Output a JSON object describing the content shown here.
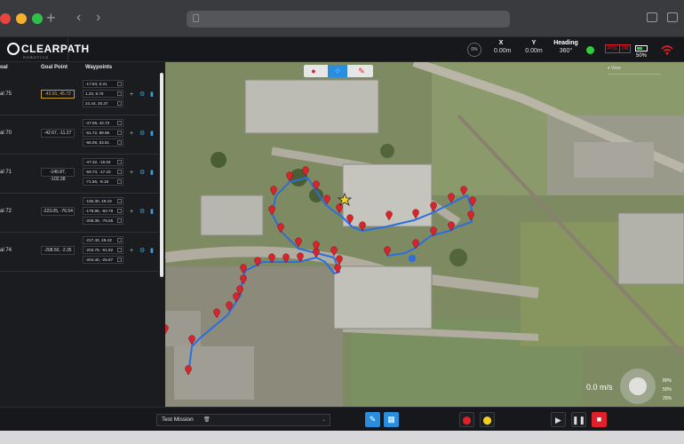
{
  "app": {
    "brand": "CLEARPATH",
    "brand_sub": "ROBOTICS"
  },
  "status": {
    "speed_pct": "0%",
    "x_label": "X",
    "x_value": "0.00m",
    "y_label": "Y",
    "y_value": "0.00m",
    "heading_label": "Heading",
    "heading_value": "360°",
    "estop1": "POS",
    "estop2": "DR",
    "battery_pct": "50%",
    "battery_level": 0.5
  },
  "panel": {
    "col_goal": "oal",
    "col_goal_point": "Goal Point",
    "col_waypoints": "Waypoints",
    "goals": [
      {
        "name": "al 75",
        "goal_point": "-42.91, 45.72",
        "highlight": true,
        "waypoints": [
          "-17.63, 0.31",
          "1.23, 9.70",
          "24.44, 20.37"
        ]
      },
      {
        "name": "al 70",
        "goal_point": "-42.67, -11.27",
        "highlight": false,
        "waypoints": [
          "-47.06, 43.73",
          "-51.72, 99.96",
          "-56.08, 53.51"
        ]
      },
      {
        "name": "al 71",
        "goal_point": "-140.87, -102.38",
        "highlight": false,
        "waypoints": [
          "-47.32, -16.04",
          "-59.73, -17.23",
          "-71.56, -9.19"
        ]
      },
      {
        "name": "al 72",
        "goal_point": "-223.05, -76.54",
        "highlight": false,
        "waypoints": [
          "-155.30, 49.19",
          "-179.86, -60.78",
          "-208.38, -75.55"
        ]
      },
      {
        "name": "al 74",
        "goal_point": "-208.50, -2.35",
        "highlight": false,
        "waypoints": [
          "-217.40, 49.43",
          "-203.79, -61.82",
          "-204.40, -25.67"
        ]
      }
    ]
  },
  "map": {
    "speed": "0.0 m/s",
    "view_label": "View",
    "zoom_levels": [
      "80%",
      "50%",
      "25%"
    ]
  },
  "bottom": {
    "mission_name": "Test Mission"
  }
}
